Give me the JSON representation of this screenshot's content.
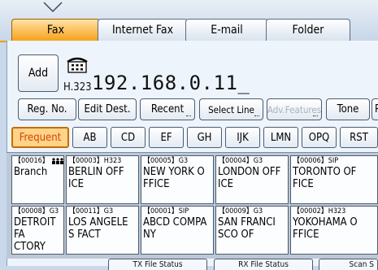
{
  "tabs": [
    {
      "label": "Fax",
      "active": true
    },
    {
      "label": "Internet Fax",
      "active": false
    },
    {
      "label": "E-mail",
      "active": false
    },
    {
      "label": "Folder",
      "active": false
    }
  ],
  "add_button": "Add",
  "destination": {
    "protocol": "H.323",
    "number": "192.168.0.11_"
  },
  "toolbar": {
    "reg_no": "Reg. No.",
    "edit_dest": "Edit Dest.",
    "recent": "Recent",
    "select_line": "Select Line",
    "adv_features": "Adv.Features",
    "tone": "Tone",
    "cut_off": "P"
  },
  "index_tabs": [
    "Frequent",
    "AB",
    "CD",
    "EF",
    "GH",
    "IJK",
    "LMN",
    "OPQ",
    "RST"
  ],
  "entries": [
    {
      "num": "【00016】",
      "type": "group",
      "name": "Branch"
    },
    {
      "num": "【00003】",
      "type": "H323",
      "name": "BERLIN OFF\nICE"
    },
    {
      "num": "【00005】",
      "type": "G3",
      "name": "NEW YORK O\nFFICE"
    },
    {
      "num": "【00004】",
      "type": "G3",
      "name": "LONDON OFF\nICE"
    },
    {
      "num": "【00006】",
      "type": "SIP",
      "name": "TORONTO OF\nFICE"
    },
    {
      "num": "【00008】",
      "type": "G3",
      "name": "DETROIT FA\nCTORY"
    },
    {
      "num": "【00011】",
      "type": "G3",
      "name": "LOS ANGELE\nS FACT"
    },
    {
      "num": "【00001】",
      "type": "SIP",
      "name": "ABCD COMPA\nNY"
    },
    {
      "num": "【00009】",
      "type": "G3",
      "name": "SAN FRANCI\nSCO OF"
    },
    {
      "num": "【00002】",
      "type": "H323",
      "name": "YOKOHAMA O\nFFICE"
    }
  ],
  "bottom": {
    "tx_file_status": "TX File Status",
    "rx_file_status": "RX File Status",
    "cut_off": "Scan S"
  },
  "colors": {
    "active_tab": "#f6a21c",
    "background": "#c9d8ea",
    "index_active_text": "#d04800"
  },
  "icons": {
    "fax_phone": "phone-handset-icon",
    "group": "group-icon"
  }
}
